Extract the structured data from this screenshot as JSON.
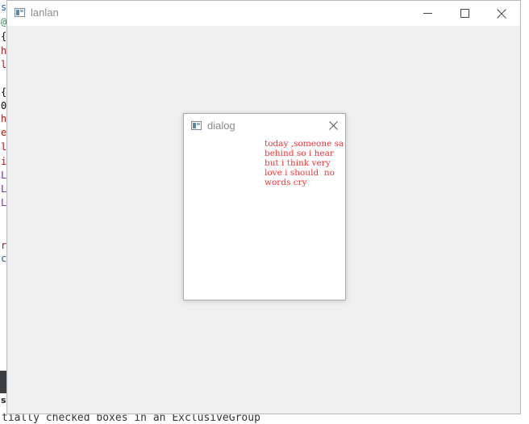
{
  "background": {
    "editor_chars": [
      {
        "text": "s",
        "color": "#1e5bb8"
      },
      {
        "text": "@",
        "color": "#2e8b57"
      },
      {
        "text": "{",
        "color": "#000000"
      },
      {
        "text": "h",
        "color": "#a31515"
      },
      {
        "text": "l",
        "color": "#a31515"
      },
      {
        "text": "",
        "color": "#000000"
      },
      {
        "text": "{",
        "color": "#000000"
      },
      {
        "text": "0",
        "color": "#000000"
      },
      {
        "text": "h",
        "color": "#a31515"
      },
      {
        "text": "e",
        "color": "#a31515"
      },
      {
        "text": "l",
        "color": "#a31515"
      },
      {
        "text": "i",
        "color": "#a31515"
      },
      {
        "text": "L",
        "color": "#7b2fa6"
      },
      {
        "text": "L",
        "color": "#7b2fa6"
      },
      {
        "text": "L",
        "color": "#7b2fa6"
      },
      {
        "text": "",
        "color": "#000000"
      },
      {
        "text": "",
        "color": "#000000"
      },
      {
        "text": "r",
        "color": "#a31515"
      },
      {
        "text": "c",
        "color": "#1e5bb8"
      }
    ],
    "strip_char": "s",
    "bottom_text": "tially checked boxes in an ExclusiveGroup"
  },
  "main_window": {
    "title": "lanlan",
    "icon": "app-window-icon",
    "controls": [
      "minimize-icon",
      "maximize-icon",
      "close-icon"
    ]
  },
  "dialog": {
    "title": "dialog",
    "icon": "app-window-icon",
    "close_icon": "close-icon",
    "text_color": "#ff3030",
    "lines": [
      "today ,someone sa",
      "behind so i hear",
      "but i think very",
      "love i should  no",
      "words cry"
    ]
  }
}
